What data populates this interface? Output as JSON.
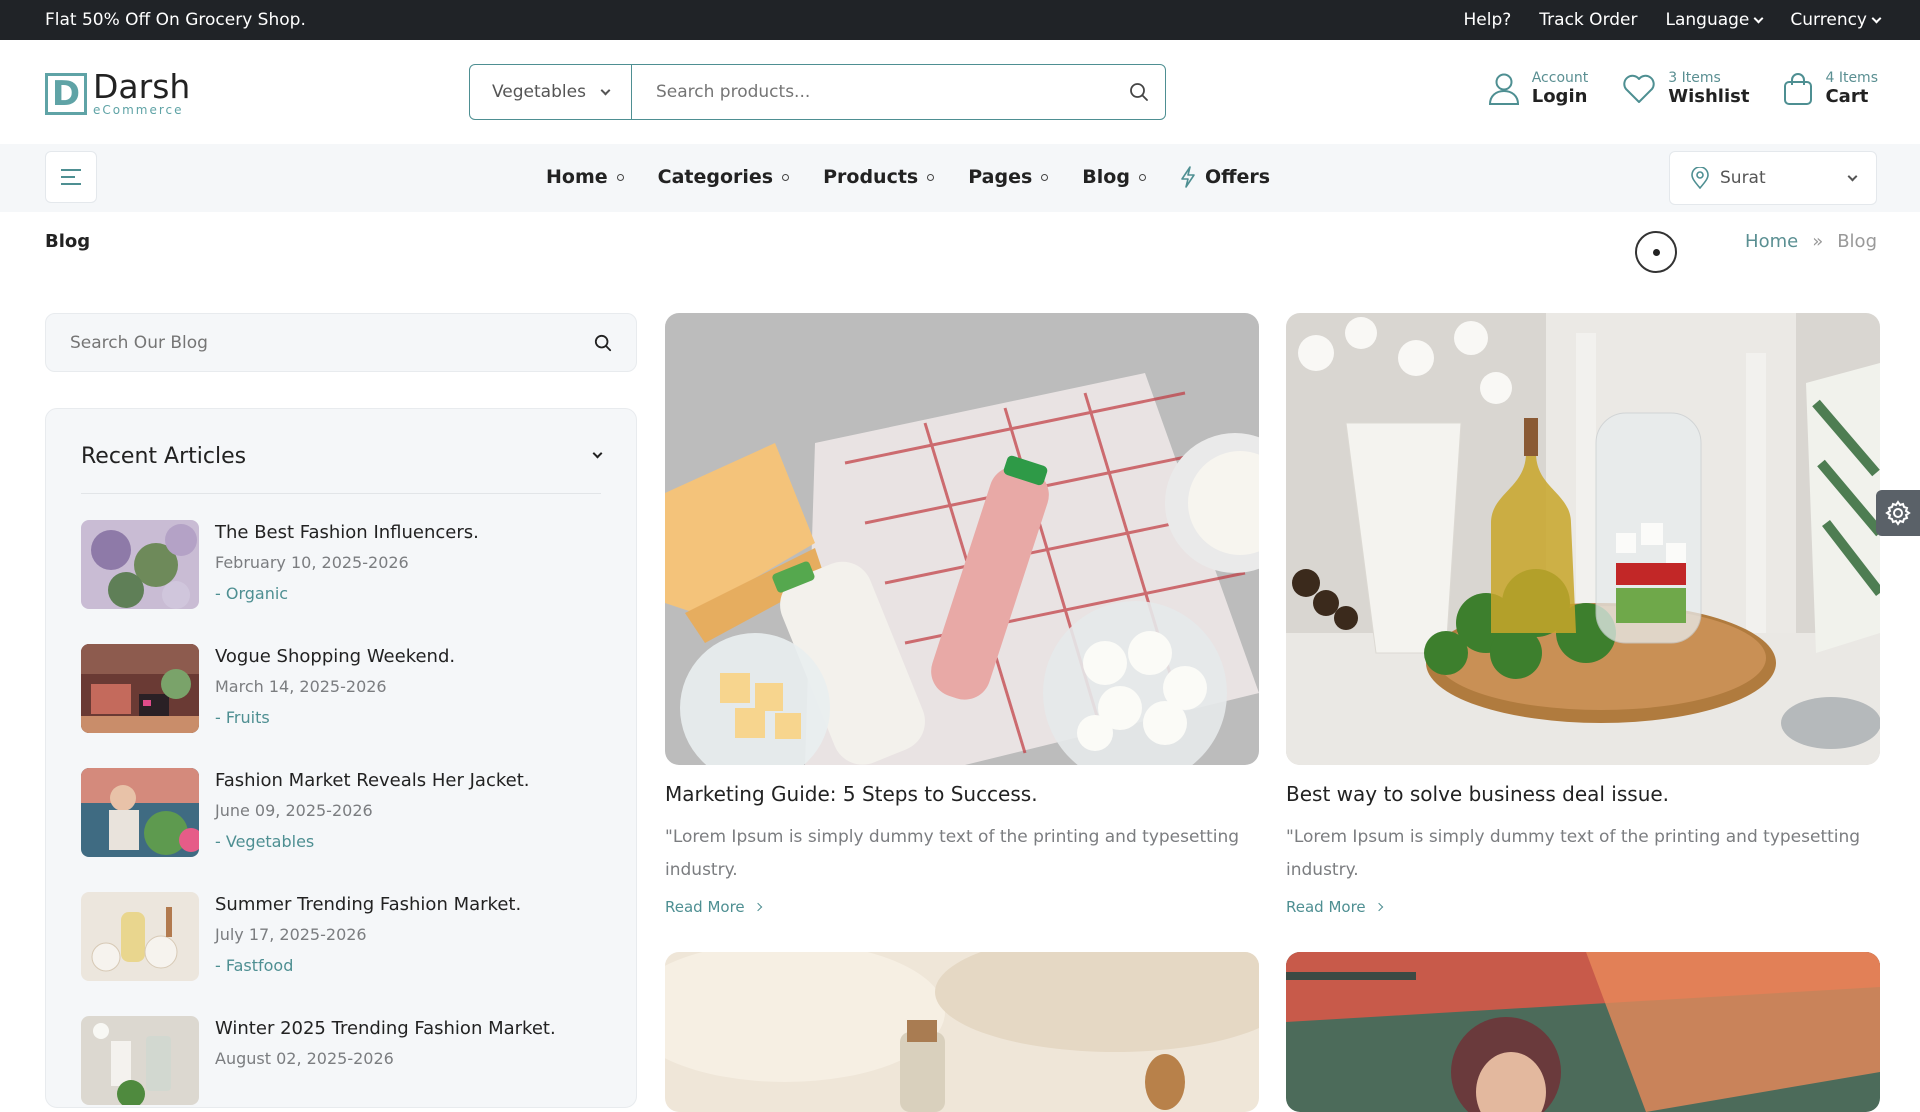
{
  "topbar": {
    "promo": "Flat 50% Off On Grocery Shop.",
    "links": [
      "Help?",
      "Track Order",
      "Language",
      "Currency"
    ]
  },
  "header": {
    "logo_name": "Darsh",
    "logo_tag": "eCommerce",
    "logo_letter": "D",
    "category_value": "Vegetables",
    "search_placeholder": "Search products...",
    "account": {
      "small": "Account",
      "big": "Login"
    },
    "wishlist": {
      "small": "3 Items",
      "big": "Wishlist"
    },
    "cart": {
      "small": "4 Items",
      "big": "Cart"
    }
  },
  "nav": {
    "items": [
      "Home",
      "Categories",
      "Products",
      "Pages",
      "Blog"
    ],
    "offers": "Offers",
    "location": "Surat"
  },
  "breadcrumb": {
    "title": "Blog",
    "home": "Home",
    "sep": "»",
    "current": "Blog"
  },
  "sidebar": {
    "search_placeholder": "Search Our Blog",
    "recent_title": "Recent Articles",
    "articles": [
      {
        "title": "The Best Fashion Influencers.",
        "date": "February 10, 2025-2026",
        "category": "- Organic"
      },
      {
        "title": "Vogue Shopping Weekend.",
        "date": "March 14, 2025-2026",
        "category": "- Fruits"
      },
      {
        "title": "Fashion Market Reveals Her Jacket.",
        "date": "June 09, 2025-2026",
        "category": "- Vegetables"
      },
      {
        "title": "Summer Trending Fashion Market.",
        "date": "July 17, 2025-2026",
        "category": "- Fastfood"
      },
      {
        "title": "Winter 2025 Trending Fashion Market.",
        "date": "August 02, 2025-2026",
        "category": ""
      }
    ]
  },
  "posts": [
    {
      "title": "Marketing Guide: 5 Steps to Success.",
      "excerpt": "\"Lorem Ipsum is simply dummy text of the printing and typesetting industry.",
      "read_more": "Read More"
    },
    {
      "title": "Best way to solve business deal issue.",
      "excerpt": "\"Lorem Ipsum is simply dummy text of the printing and typesetting industry.",
      "read_more": "Read More"
    }
  ],
  "colors": {
    "accent": "#4e8f92",
    "topbar": "#202327",
    "panel": "#f5f7f9"
  }
}
